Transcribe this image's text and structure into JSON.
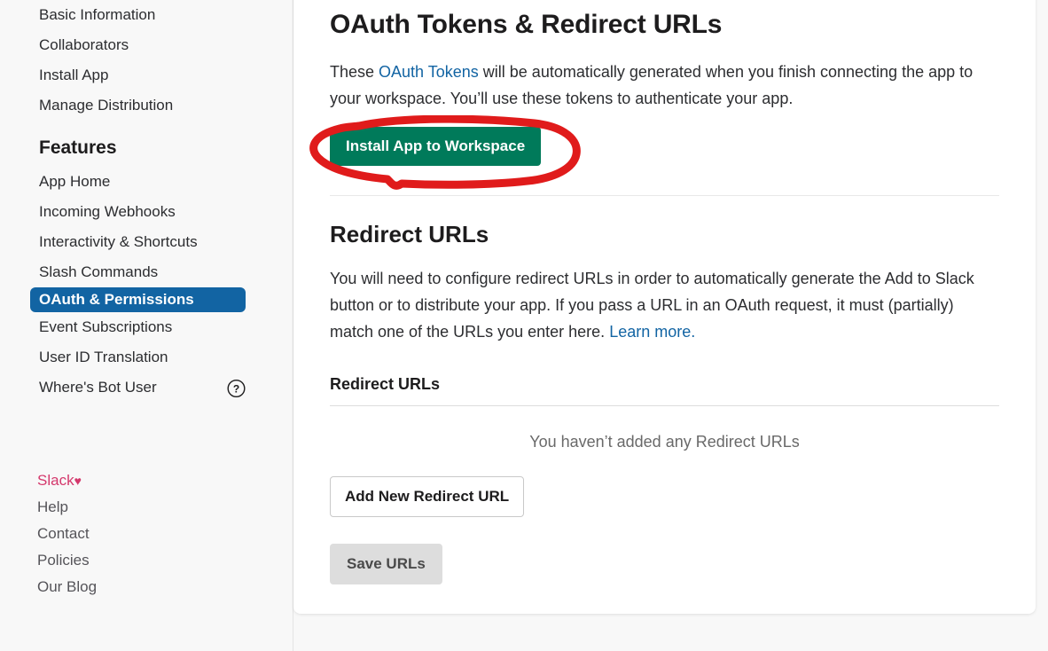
{
  "colors": {
    "accent_blue": "#1264a3",
    "install_green": "#007a5a",
    "brand_pink": "#d4386c",
    "annotation_red": "#e01b1b",
    "save_grey": "#dddddd",
    "page_bg": "#f8f8f8"
  },
  "sidebar": {
    "top_items": [
      {
        "label": "Basic Information"
      },
      {
        "label": "Collaborators"
      },
      {
        "label": "Install App"
      },
      {
        "label": "Manage Distribution"
      }
    ],
    "section_title": "Features",
    "feature_items": [
      {
        "label": "App Home",
        "active": false,
        "help": false
      },
      {
        "label": "Incoming Webhooks",
        "active": false,
        "help": false
      },
      {
        "label": "Interactivity & Shortcuts",
        "active": false,
        "help": false
      },
      {
        "label": "Slash Commands",
        "active": false,
        "help": false
      },
      {
        "label": "OAuth & Permissions",
        "active": true,
        "help": false
      },
      {
        "label": "Event Subscriptions",
        "active": false,
        "help": false
      },
      {
        "label": "User ID Translation",
        "active": false,
        "help": false
      },
      {
        "label": "Where's Bot User",
        "active": false,
        "help": true
      }
    ],
    "help_icon_name": "question-mark-circle-icon",
    "footer": {
      "brand_label": "Slack",
      "heart": "♥",
      "links": [
        {
          "label": "Help"
        },
        {
          "label": "Contact"
        },
        {
          "label": "Policies"
        },
        {
          "label": "Our Blog"
        }
      ]
    }
  },
  "main": {
    "page_title": "OAuth Tokens & Redirect URLs",
    "intro": {
      "before_link": "These ",
      "link_text": "OAuth Tokens",
      "after_link": " will be automatically generated when you finish connecting the app to your workspace. You’ll use these tokens to authenticate your app."
    },
    "install_button_label": "Install App to Workspace",
    "redirect_section": {
      "title": "Redirect URLs",
      "description_before_link": "You will need to configure redirect URLs in order to automatically generate the Add to Slack button or to distribute your app. If you pass a URL in an OAuth request, it must (partially) match one of the URLs you enter here. ",
      "learn_more_label": "Learn more.",
      "sub_title": "Redirect URLs",
      "empty_state": "You haven’t added any Redirect URLs",
      "add_button_label": "Add New Redirect URL",
      "save_button_label": "Save URLs"
    }
  },
  "annotation": {
    "shape": "hand-drawn-red-ellipse",
    "targets": "install-app-to-workspace-button"
  }
}
